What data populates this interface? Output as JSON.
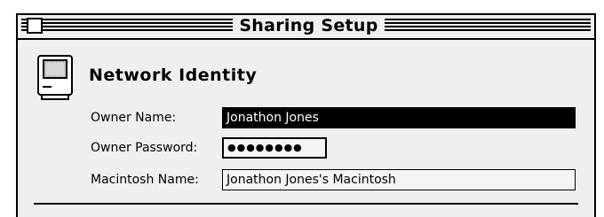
{
  "window": {
    "title": "Sharing Setup"
  },
  "section": {
    "heading": "Network Identity"
  },
  "fields": {
    "owner_name": {
      "label": "Owner Name:",
      "value": "Jonathon Jones"
    },
    "owner_password": {
      "label": "Owner Password:",
      "value": "●●●●●●●●"
    },
    "macintosh_name": {
      "label": "Macintosh Name:",
      "value": "Jonathon Jones's Macintosh"
    }
  },
  "icons": {
    "close": "close-box-icon",
    "section": "macintosh-computer-icon"
  }
}
